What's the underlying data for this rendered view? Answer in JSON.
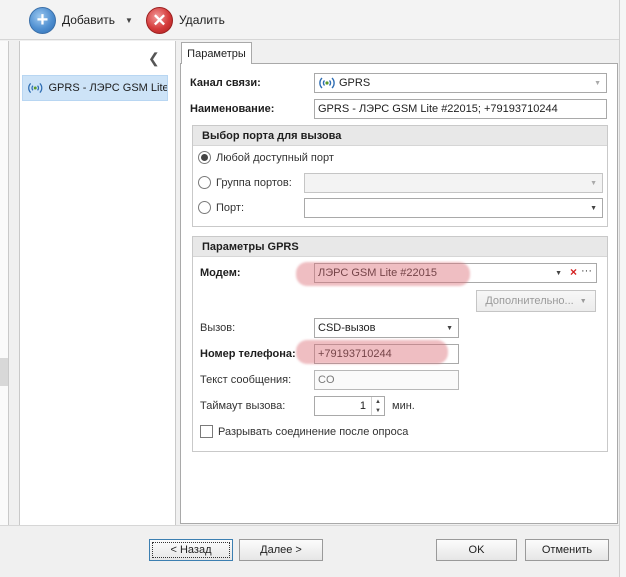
{
  "toolbar": {
    "add_label": "Добавить",
    "delete_label": "Удалить"
  },
  "nav": {
    "items": [
      {
        "label": "GPRS - ЛЭРС GSM Lite..."
      }
    ]
  },
  "tabs": [
    {
      "label": "Параметры"
    }
  ],
  "form": {
    "channel_label": "Канал связи:",
    "channel_value": "GPRS",
    "name_label": "Наименование:",
    "name_value": "GPRS - ЛЭРС GSM Lite #22015; +79193710244"
  },
  "port_group": {
    "title": "Выбор порта для вызова",
    "any_port_label": "Любой доступный порт",
    "port_group_label": "Группа портов:",
    "port_label": "Порт:",
    "port_group_value": "",
    "port_value": ""
  },
  "gprs_group": {
    "title": "Параметры GPRS",
    "modem_label": "Модем:",
    "modem_value": "ЛЭРС GSM Lite #22015",
    "advanced_label": "Дополнительно...",
    "call_label": "Вызов:",
    "call_value": "CSD-вызов",
    "phone_label": "Номер телефона:",
    "phone_value": "+79193710244",
    "message_label": "Текст сообщения:",
    "message_value": "CO",
    "timeout_label": "Таймаут вызова:",
    "timeout_value": "1",
    "timeout_unit": "мин.",
    "disconnect_label": "Разрывать соединение после опроса"
  },
  "footer": {
    "back_label": "< Назад",
    "next_label": "Далее >",
    "ok_label": "OK",
    "cancel_label": "Отменить"
  },
  "colors": {
    "selection": "#cde3f7",
    "highlight": "#dc6e78"
  }
}
